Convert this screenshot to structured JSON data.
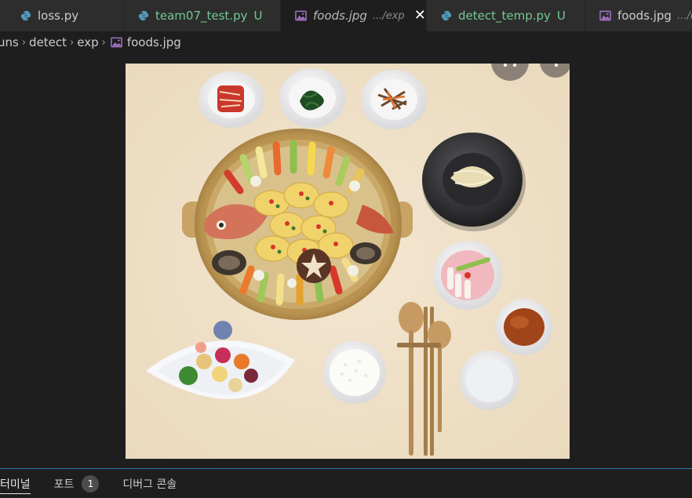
{
  "tabs": [
    {
      "label": "loss.py",
      "kind": "python",
      "status": "normal"
    },
    {
      "label": "team07_test.py",
      "kind": "python",
      "status": "untracked",
      "badge": "U"
    },
    {
      "label": "foods.jpg",
      "description": ".../exp",
      "kind": "image",
      "status": "preview-active",
      "close": "✕"
    },
    {
      "label": "detect_temp.py",
      "kind": "python",
      "status": "untracked",
      "badge": "U"
    },
    {
      "label": "foods.jpg",
      "description": ".../ı",
      "kind": "image",
      "status": "normal"
    }
  ],
  "breadcrumb": {
    "segments": [
      "uns",
      "detect",
      "exp"
    ],
    "file": "foods.jpg",
    "separator": "›"
  },
  "panel": {
    "tabs": [
      {
        "label": "터미널",
        "active": true
      },
      {
        "label": "포트",
        "badge": "1"
      },
      {
        "label": "디버그 콘솔"
      }
    ]
  },
  "colors": {
    "editor_bg": "#1e1e1e",
    "tab_bg": "#2d2d2d",
    "untracked": "#73c991",
    "python_icon": "#519aba",
    "image_icon": "#a074c4",
    "panel_border": "#2b79a8"
  }
}
